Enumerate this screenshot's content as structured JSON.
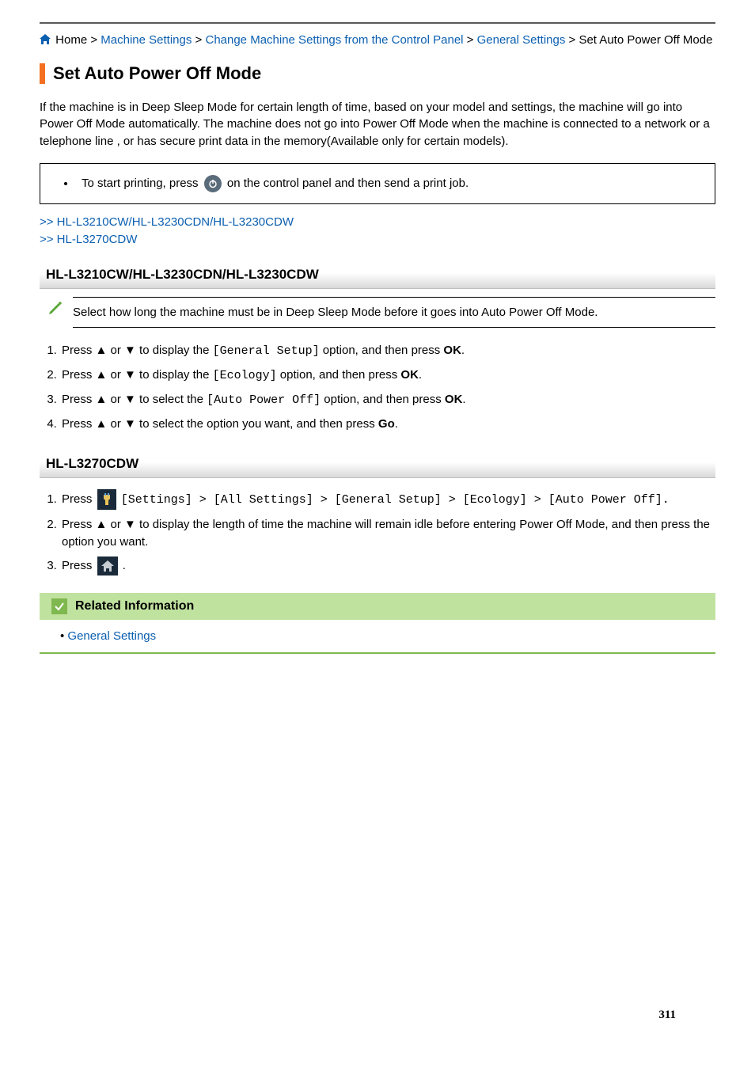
{
  "breadcrumb": {
    "home": "Home",
    "sep": ">",
    "l1": "Machine Settings",
    "l2": "Change Machine Settings from the Control Panel",
    "l3": "General Settings",
    "tail": "Set Auto Power Off Mode"
  },
  "title": "Set Auto Power Off Mode",
  "intro": "If the machine is in Deep Sleep Mode for certain length of time, based on your model and settings, the machine will go into Power Off Mode automatically. The machine does not go into Power Off Mode when the machine is connected to a network or a telephone line , or has secure print data in the memory(Available only for certain models).",
  "note": {
    "pre": "To start printing, press ",
    "post": " on the control panel and then send a print job."
  },
  "anchors": {
    "a1": ">> HL-L3210CW/HL-L3230CDN/HL-L3230CDW",
    "a2": ">> HL-L3270CDW"
  },
  "sectA": {
    "heading": "HL-L3210CW/HL-L3230CDN/HL-L3230CDW",
    "pencil": "Select how long the machine must be in Deep Sleep Mode before it goes into Auto Power Off Mode.",
    "steps": [
      {
        "pre": "Press ▲ or ▼ to display the ",
        "mono": "[General Setup]",
        "mid": " option, and then press ",
        "bold": "OK",
        "post": "."
      },
      {
        "pre": "Press ▲ or ▼ to display the ",
        "mono": "[Ecology]",
        "mid": " option, and then press ",
        "bold": "OK",
        "post": "."
      },
      {
        "pre": "Press ▲ or ▼ to select the ",
        "mono": "[Auto Power Off]",
        "mid": " option, and then press ",
        "bold": "OK",
        "post": "."
      },
      {
        "pre": "Press ▲ or ▼ to select the option you want, and then press ",
        "mono": "",
        "mid": "",
        "bold": "Go",
        "post": "."
      }
    ]
  },
  "sectB": {
    "heading": "HL-L3270CDW",
    "step1": {
      "pre": "Press ",
      "chain": "[Settings] > [All Settings] > [General Setup] > [Ecology] > [Auto Power Off].",
      "sep": " > "
    },
    "step2": "Press ▲ or ▼ to display the length of time the machine will remain idle before entering Power Off Mode, and then press the option you want.",
    "step3": {
      "pre": "Press ",
      "post": "."
    }
  },
  "related": {
    "heading": "Related Information",
    "item": "General Settings"
  },
  "pageNumber": "311"
}
